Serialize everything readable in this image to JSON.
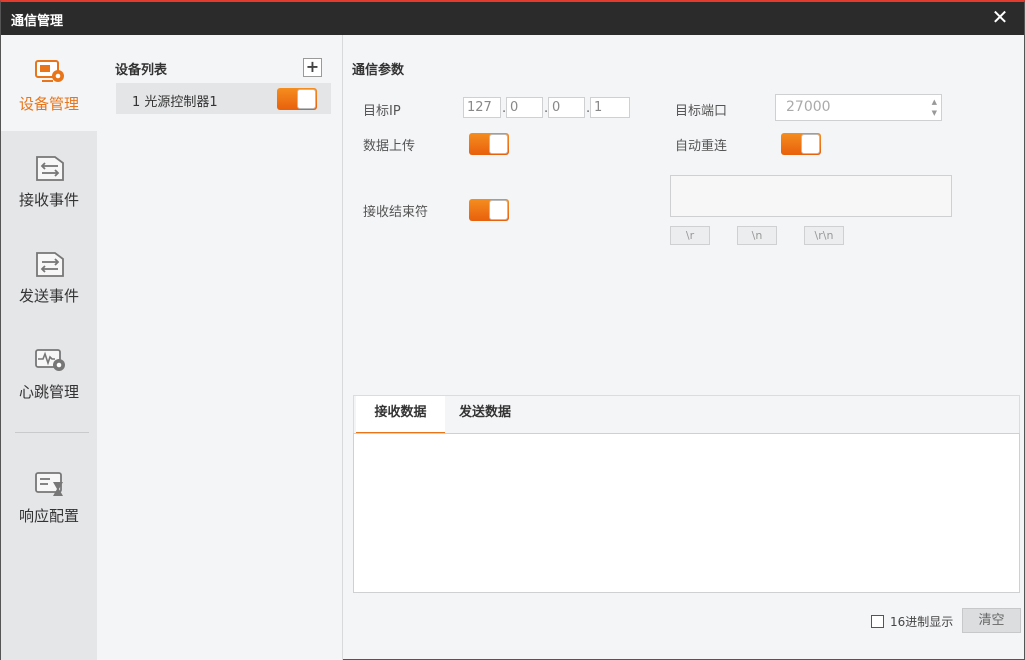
{
  "window": {
    "title": "通信管理",
    "close_icon": "close-icon"
  },
  "nav": {
    "items": [
      {
        "label": "设备管理",
        "icon": "device-gear-icon",
        "active": true
      },
      {
        "label": "接收事件",
        "icon": "receive-event-icon",
        "active": false
      },
      {
        "label": "发送事件",
        "icon": "send-event-icon",
        "active": false
      },
      {
        "label": "心跳管理",
        "icon": "heartbeat-gear-icon",
        "active": false
      },
      {
        "label": "响应配置",
        "icon": "response-config-icon",
        "active": false
      }
    ]
  },
  "device_list": {
    "header": "设备列表",
    "add_label": "+",
    "devices": [
      {
        "name": "1 光源控制器1",
        "enabled": true
      }
    ]
  },
  "params": {
    "title": "通信参数",
    "target_ip_label": "目标IP",
    "ip": [
      "127",
      "0",
      "0",
      "1"
    ],
    "ip_sep": ".",
    "port_label": "目标端口",
    "port_value": "27000",
    "upload_label": "数据上传",
    "upload_on": true,
    "reconnect_label": "自动重连",
    "reconnect_on": true,
    "terminator_label": "接收结束符",
    "terminator_on": true,
    "terminator_buttons": [
      "\\r",
      "\\n",
      "\\r\\n"
    ]
  },
  "data_tabs": {
    "tabs": [
      {
        "label": "接收数据",
        "active": true
      },
      {
        "label": "发送数据",
        "active": false
      }
    ]
  },
  "footer": {
    "hex_label": "16进制显示",
    "hex_checked": false,
    "clear_label": "清空"
  },
  "colors": {
    "accent": "#e8751a",
    "titlebar": "#2b2b2b",
    "top_border": "#e33b2e"
  }
}
